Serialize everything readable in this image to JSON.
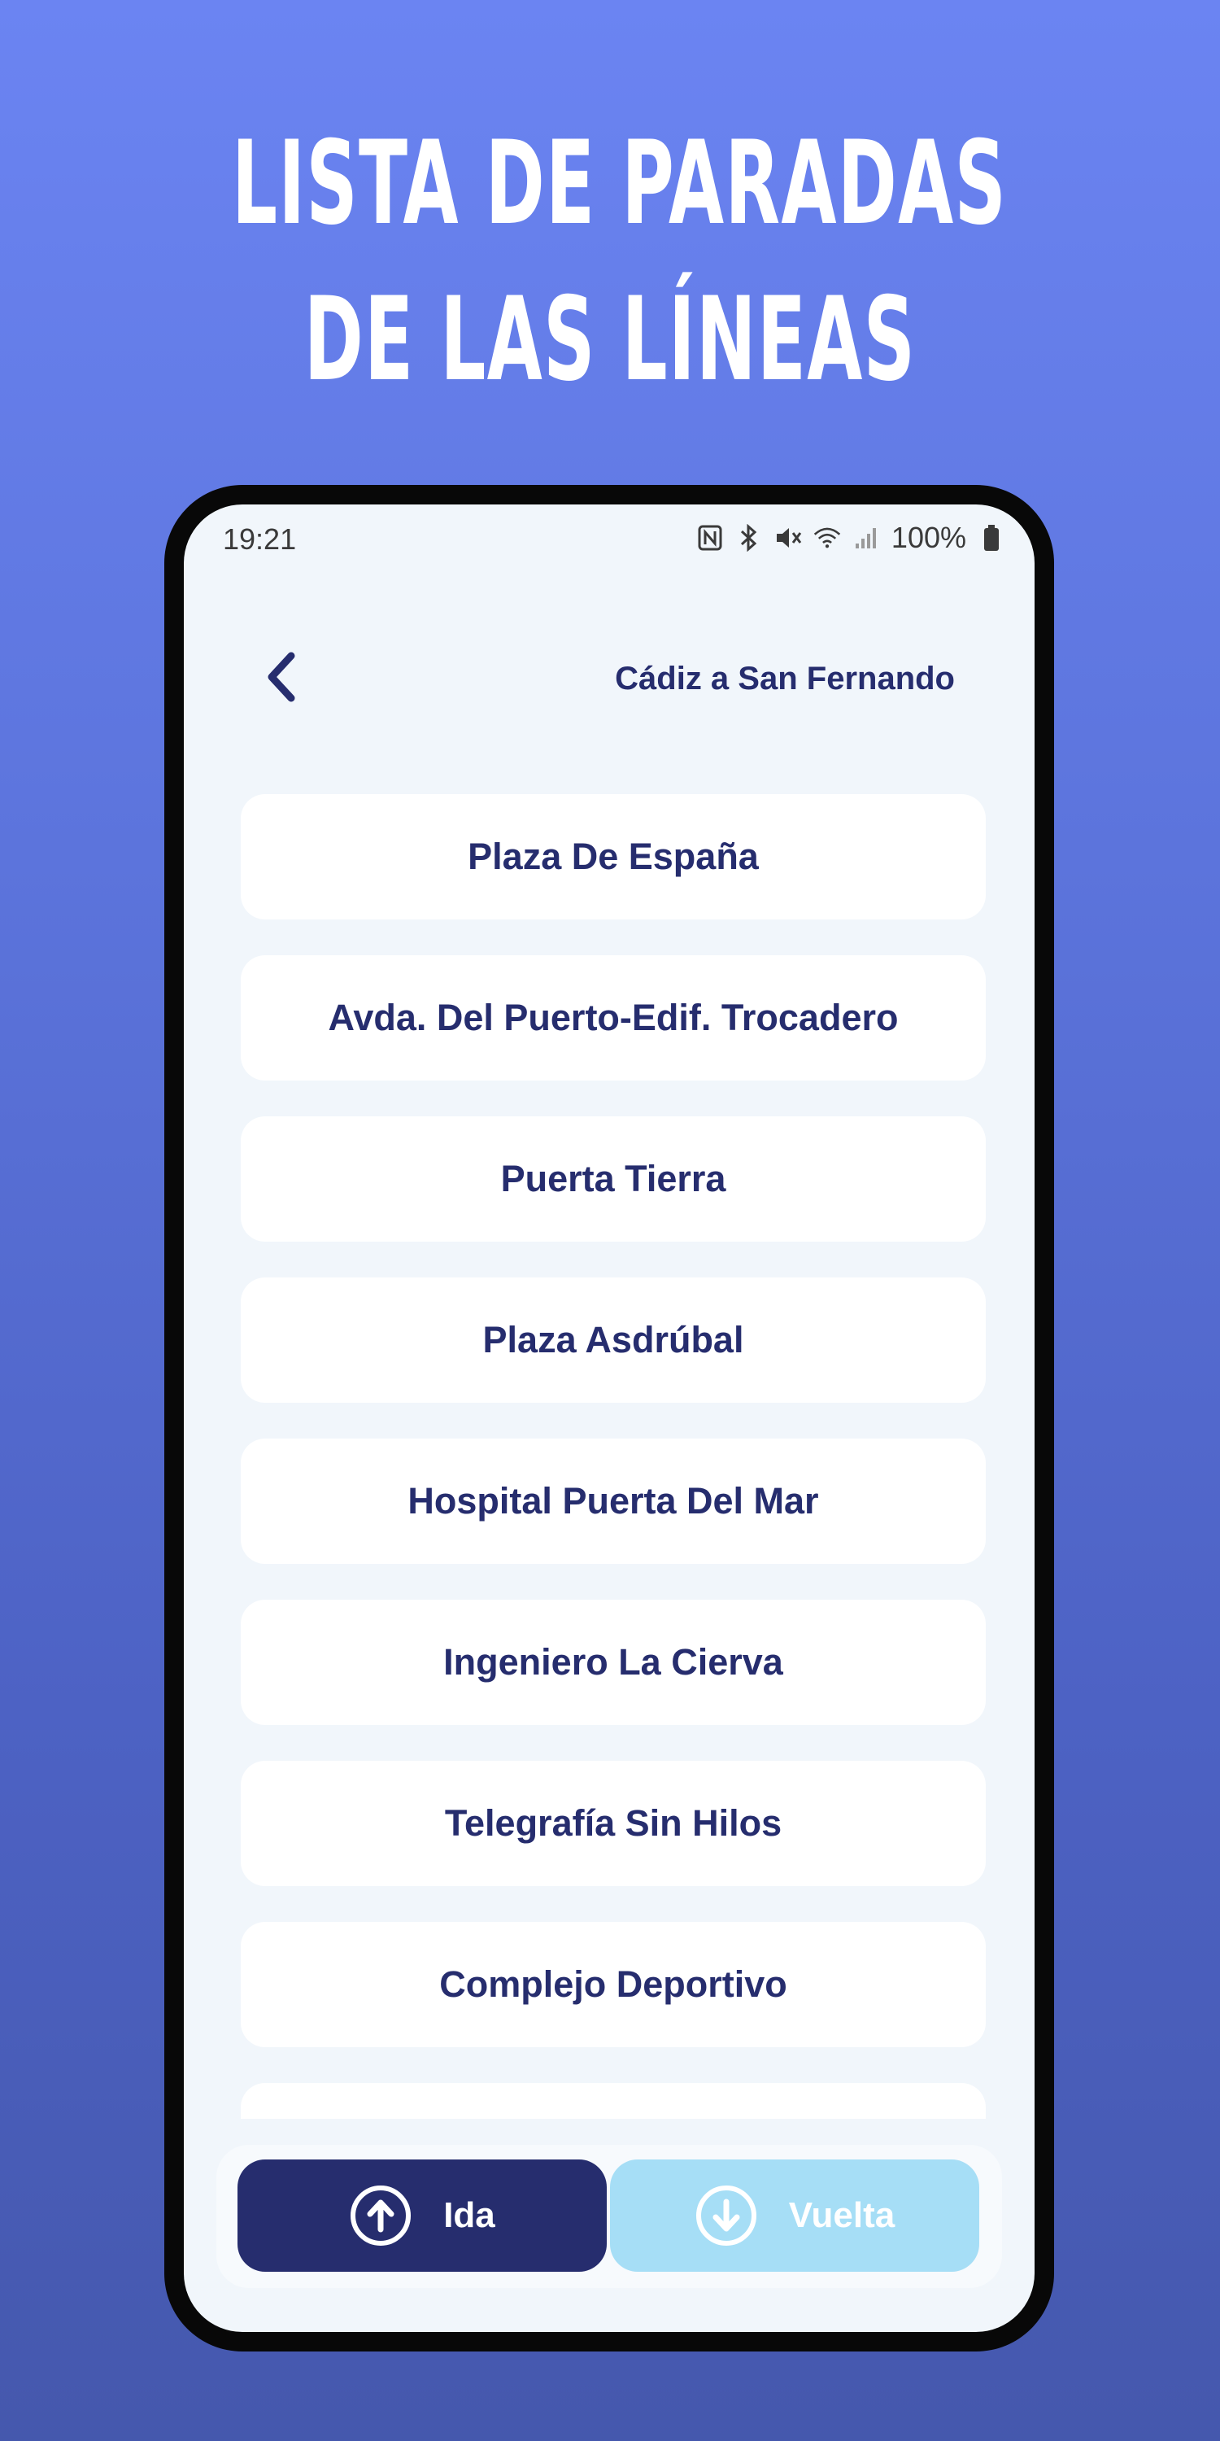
{
  "promo": {
    "line1": "LISTA DE PARADAS",
    "line2": "DE LAS LÍNEAS"
  },
  "status_bar": {
    "time": "19:21",
    "battery_percent": "100%",
    "icons": [
      "nfc-icon",
      "bluetooth-icon",
      "mute-icon",
      "wifi-icon",
      "signal-icon",
      "battery-icon"
    ]
  },
  "header": {
    "back_icon": "chevron-left-icon",
    "title": "Cádiz a San Fernando"
  },
  "stops": [
    "Plaza De España",
    "Avda. Del Puerto-Edif. Trocadero",
    "Puerta Tierra",
    "Plaza Asdrúbal",
    "Hospital Puerta Del Mar",
    "Ingeniero La Cierva",
    "Telegrafía Sin Hilos",
    "Complejo Deportivo",
    ""
  ],
  "direction_tabs": {
    "ida": {
      "label": "Ida",
      "icon": "arrow-up-circle-icon",
      "selected": true
    },
    "vuelta": {
      "label": "Vuelta",
      "icon": "arrow-down-circle-icon",
      "selected": false
    }
  },
  "colors": {
    "background_top": "#6b84f2",
    "background_bottom": "#4558ad",
    "primary_dark": "#262d6e",
    "inactive_light_blue": "#a6def6",
    "screen_bg": "#f1f6fb"
  }
}
